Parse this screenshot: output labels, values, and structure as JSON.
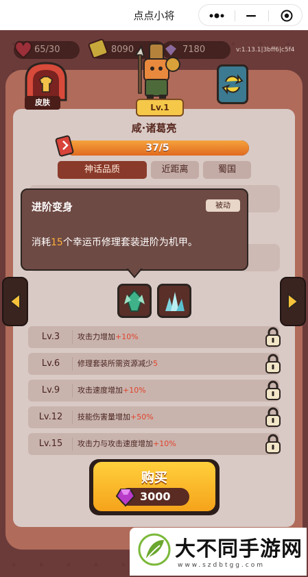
{
  "titlebar": {
    "title": "点点小将"
  },
  "resources": {
    "hearts": "65/30",
    "coins": "8090",
    "gems": "7180"
  },
  "version": "v:1.13.1|3bff6|c5f4",
  "skin_button": {
    "label": "皮肤"
  },
  "hero": {
    "level": "Lv.1",
    "name": "咸·诸葛亮",
    "xp_text": "37/5",
    "xp_fraction": 1.0,
    "tags": {
      "quality": "神话品质",
      "range": "近距离",
      "faction": "蜀国"
    }
  },
  "tooltip": {
    "title": "进阶变身",
    "badge": "被动",
    "desc_prefix": "消耗",
    "desc_number": "15",
    "desc_suffix": "个幸运币修理套装进阶为机甲。"
  },
  "levels": [
    {
      "lv": "Lv.3",
      "text": "攻击力增加",
      "value": "+10%"
    },
    {
      "lv": "Lv.6",
      "text": "修理套装所需资源减少",
      "value": "5"
    },
    {
      "lv": "Lv.9",
      "text": "攻击速度增加",
      "value": "+10%"
    },
    {
      "lv": "Lv.12",
      "text": "技能伤害量增加",
      "value": "+50%"
    },
    {
      "lv": "Lv.15",
      "text": "攻击力与攻击速度增加",
      "value": "+10%"
    }
  ],
  "buy": {
    "label": "购买",
    "price": "3000"
  },
  "watermark": {
    "brand": "大不同手游网",
    "url": "www.szdbtgg.com"
  },
  "colors": {
    "panel": "#b06b5a",
    "panel_inner": "#d9cac6",
    "accent_orange": "#f5a31a",
    "highlight": "#ffb13b"
  }
}
